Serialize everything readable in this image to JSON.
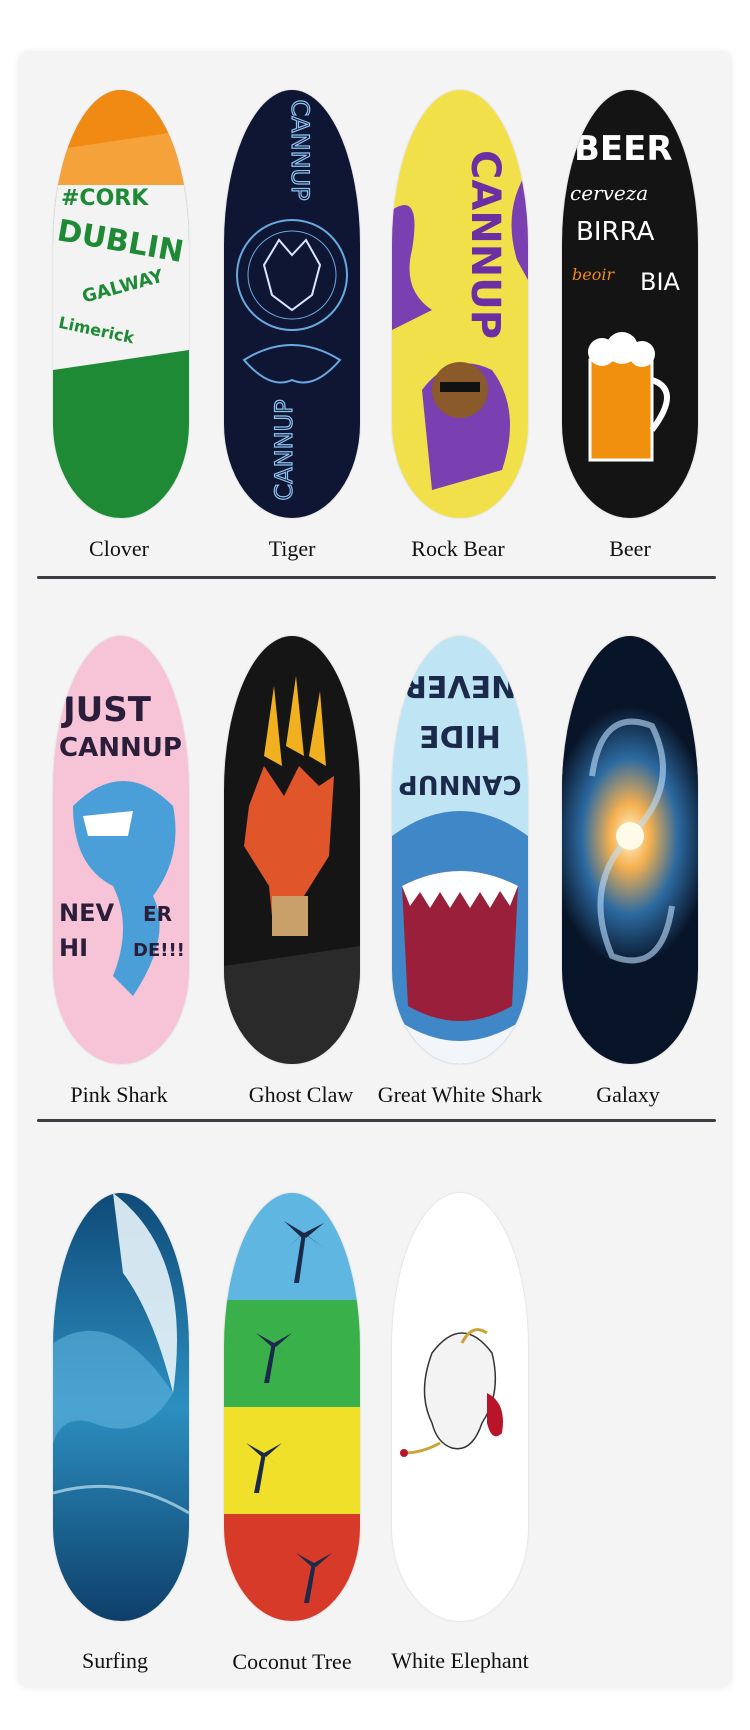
{
  "products": [
    {
      "name": "Clover",
      "deck_text": [
        "#CORK",
        "DUBLIN",
        "GALWAY",
        "Limerick"
      ]
    },
    {
      "name": "Tiger",
      "deck_text": [
        "CANNUP",
        "CANNUP"
      ]
    },
    {
      "name": "Rock Bear",
      "deck_text": [
        "CANNUP"
      ]
    },
    {
      "name": "Beer",
      "deck_text": [
        "BEER",
        "cerveza",
        "BIRRA",
        "beoir",
        "BIA"
      ]
    },
    {
      "name": "Pink Shark",
      "deck_text": [
        "JUST",
        "CANNUP",
        "NEV",
        "ER",
        "HI",
        "DE!!!"
      ]
    },
    {
      "name": "Ghost Claw",
      "deck_text": []
    },
    {
      "name": "Great White Shark",
      "deck_text": [
        "NEVER",
        "HIDE",
        "CANNUP"
      ]
    },
    {
      "name": "Galaxy",
      "deck_text": []
    },
    {
      "name": "Surfing",
      "deck_text": []
    },
    {
      "name": "Coconut Tree",
      "deck_text": []
    },
    {
      "name": "White Elephant",
      "deck_text": []
    }
  ],
  "colors": {
    "card": "#f4f4f4",
    "divider": "#3b3d42"
  }
}
